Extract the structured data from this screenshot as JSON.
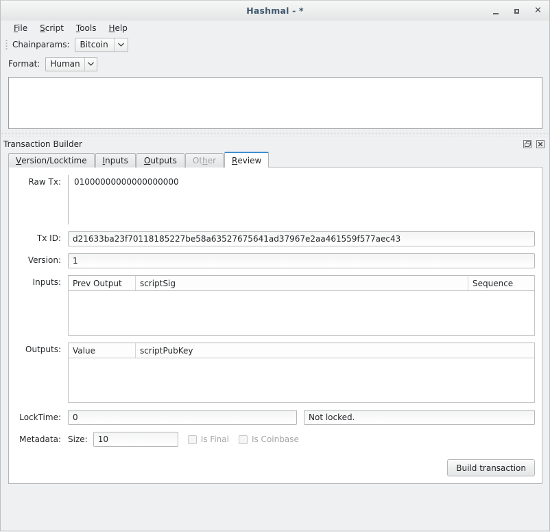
{
  "window": {
    "title": "Hashmal - *",
    "controls": {
      "minimize": "minimize-button",
      "maximize": "maximize-button",
      "close": "close-button"
    }
  },
  "menubar": {
    "items": [
      {
        "label": "File",
        "mnemonic": "F"
      },
      {
        "label": "Script",
        "mnemonic": "S"
      },
      {
        "label": "Tools",
        "mnemonic": "T"
      },
      {
        "label": "Help",
        "mnemonic": "H"
      }
    ]
  },
  "toolbar": {
    "chainparams_label": "Chainparams:",
    "chainparams_value": "Bitcoin"
  },
  "format_bar": {
    "label": "Format:",
    "value": "Human"
  },
  "editor": {
    "value": "",
    "placeholder": ""
  },
  "dock": {
    "title": "Transaction Builder",
    "float_button": "float-dock",
    "close_button": "close-dock"
  },
  "tabs": [
    {
      "label": "Version/Locktime",
      "mnemonic": "V",
      "state": "normal"
    },
    {
      "label": "Inputs",
      "mnemonic": "I",
      "state": "normal"
    },
    {
      "label": "Outputs",
      "mnemonic": "O",
      "state": "normal"
    },
    {
      "label": "Other",
      "mnemonic": "h",
      "state": "disabled"
    },
    {
      "label": "Review",
      "mnemonic": "R",
      "state": "active"
    }
  ],
  "review": {
    "raw_tx_label": "Raw Tx:",
    "raw_tx_value": "01000000000000000000",
    "tx_id_label": "Tx ID:",
    "tx_id_value": "d21633ba23f70118185227be58a63527675641ad37967e2aa461559f577aec43",
    "version_label": "Version:",
    "version_value": "1",
    "inputs_label": "Inputs:",
    "inputs_columns": [
      "Prev Output",
      "scriptSig",
      "Sequence"
    ],
    "inputs_rows": [],
    "outputs_label": "Outputs:",
    "outputs_columns": [
      "Value",
      "scriptPubKey"
    ],
    "outputs_rows": [],
    "locktime_label": "LockTime:",
    "locktime_value": "0",
    "locktime_status": "Not locked.",
    "metadata_label": "Metadata:",
    "size_label": "Size:",
    "size_value": "10",
    "is_final_label": "Is Final",
    "is_final_checked": false,
    "is_coinbase_label": "Is Coinbase",
    "is_coinbase_checked": false,
    "build_button": "Build transaction"
  },
  "colors": {
    "window_bg": "#eff0f1",
    "accent_tab": "#3f8fd2",
    "title_text": "#40586e",
    "text": "#232629",
    "disabled_text": "#a3a5a7",
    "field_border": "#b6b7b9"
  }
}
